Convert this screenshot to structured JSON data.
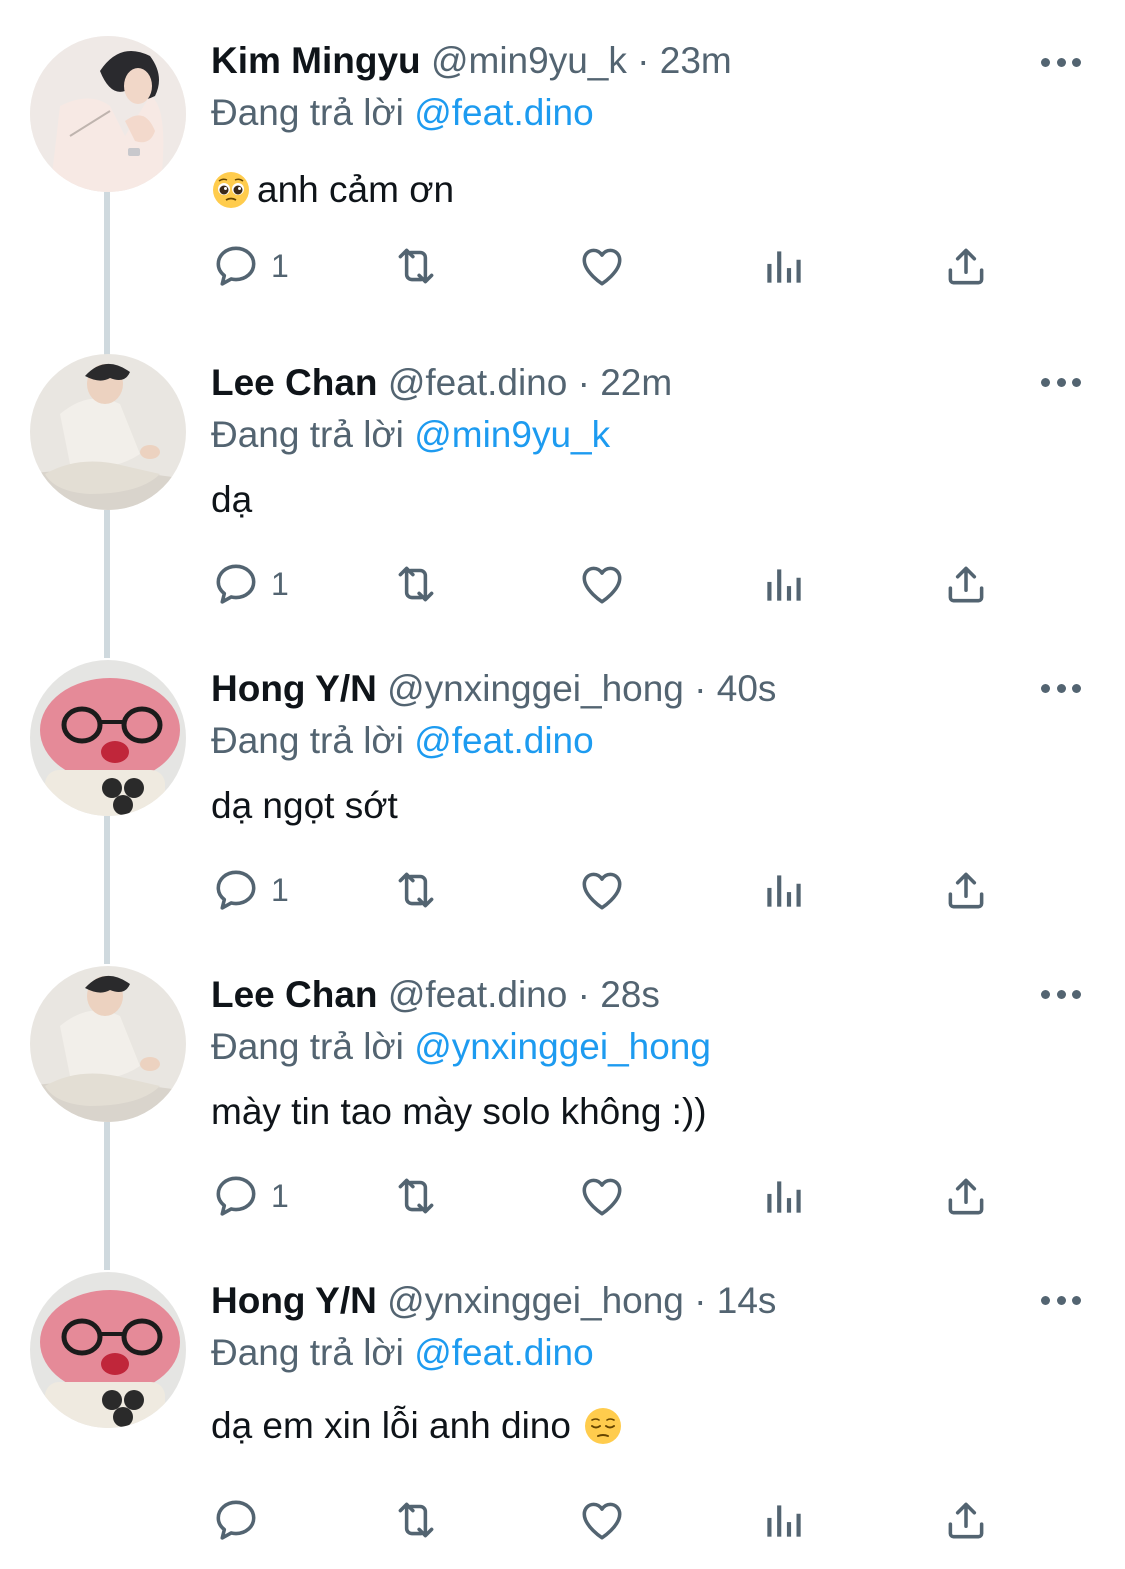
{
  "reply_prefix": "Đang trả lời",
  "tweets": [
    {
      "name": "Kim Mingyu",
      "handle": "@min9yu_k",
      "separator": "·",
      "time": "23m",
      "reply_to": "@feat.dino",
      "text": "anh cảm ơn",
      "emoji": "pleading-face",
      "reply_count": "1",
      "avatar": "kim-mingyu-photo"
    },
    {
      "name": "Lee Chan",
      "handle": "@feat.dino",
      "separator": "·",
      "time": "22m",
      "reply_to": "@min9yu_k",
      "text": "dạ",
      "emoji": "",
      "reply_count": "1",
      "avatar": "lee-chan-photo"
    },
    {
      "name": "Hong Y/N",
      "handle": "@ynxinggei_hong",
      "separator": "·",
      "time": "40s",
      "reply_to": "@feat.dino",
      "text": "dạ ngọt sớt",
      "emoji": "",
      "reply_count": "1",
      "avatar": "pink-plush-photo"
    },
    {
      "name": "Lee Chan",
      "handle": "@feat.dino",
      "separator": "·",
      "time": "28s",
      "reply_to": "@ynxinggei_hong",
      "text": "mày tin tao mày solo không :))",
      "emoji": "",
      "reply_count": "1",
      "avatar": "lee-chan-photo"
    },
    {
      "name": "Hong Y/N",
      "handle": "@ynxinggei_hong",
      "separator": "·",
      "time": "14s",
      "reply_to": "@feat.dino",
      "text": "dạ em xin lỗi anh dino",
      "emoji": "pensive-face",
      "reply_count": "",
      "avatar": "pink-plush-photo"
    }
  ],
  "colors": {
    "text": "#0f1419",
    "secondary": "#536471",
    "link": "#1d9bf0",
    "thread_line": "#cfd9de"
  }
}
